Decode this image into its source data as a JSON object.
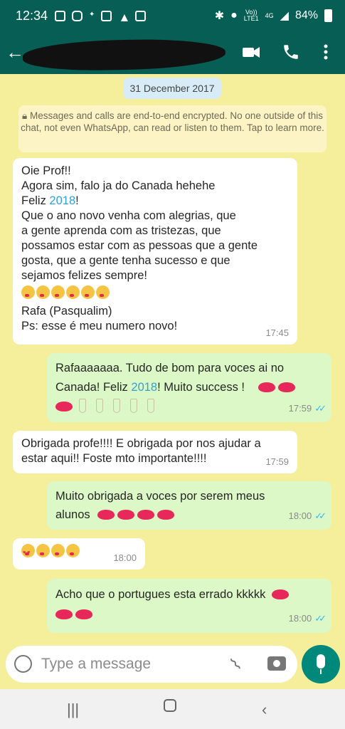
{
  "status_bar": {
    "time": "12:34",
    "network_1": "Vo))",
    "network_2": "LTE1",
    "network_3": "4G",
    "battery": "84%"
  },
  "header": {
    "back_icon": "arrow-left-icon",
    "video_icon": "video-call-icon",
    "call_icon": "phone-icon",
    "menu_icon": "more-vert-icon"
  },
  "chat": {
    "date": "31 December 2017",
    "encryption_notice": "Messages and calls are end-to-end encrypted. No one outside of this chat, not even WhatsApp, can read or listen to them. Tap to learn more.",
    "messages": [
      {
        "dir": "in",
        "lines": [
          "Oie Prof!!",
          "Agora sim, falo ja do Canada hehehe",
          "Feliz ",
          "2018",
          "!",
          "Que o ano novo venha com alegrias, que",
          "a gente aprenda com as tristezas, que",
          "possamos estar com as pessoas que a gente",
          "gosta, que a gente tenha sucesso e que",
          "sejamos felizes sempre!",
          "Rafa (Pasqualim)",
          "Ps: esse é meu numero novo!"
        ],
        "time": "17:45"
      },
      {
        "dir": "out",
        "lines": [
          "Rafaaaaaaa. Tudo de bom para voces ai no",
          "Canada! Feliz ",
          "2018",
          "! Muito success !"
        ],
        "time": "17:59"
      },
      {
        "dir": "in",
        "lines": [
          "Obrigada profe!!!! E obrigada por nos ajudar a",
          "estar aqui!! Foste mto importante!!!!"
        ],
        "time": "17:59"
      },
      {
        "dir": "out",
        "lines": [
          "Muito obrigada a voces por serem meus",
          "alunos"
        ],
        "time": "18:00"
      },
      {
        "dir": "in",
        "lines": [],
        "time": "18:00"
      },
      {
        "dir": "out",
        "lines": [
          "Acho que o portugues esta errado kkkkk"
        ],
        "time": "18:00"
      }
    ]
  },
  "input": {
    "placeholder": "Type a message"
  }
}
